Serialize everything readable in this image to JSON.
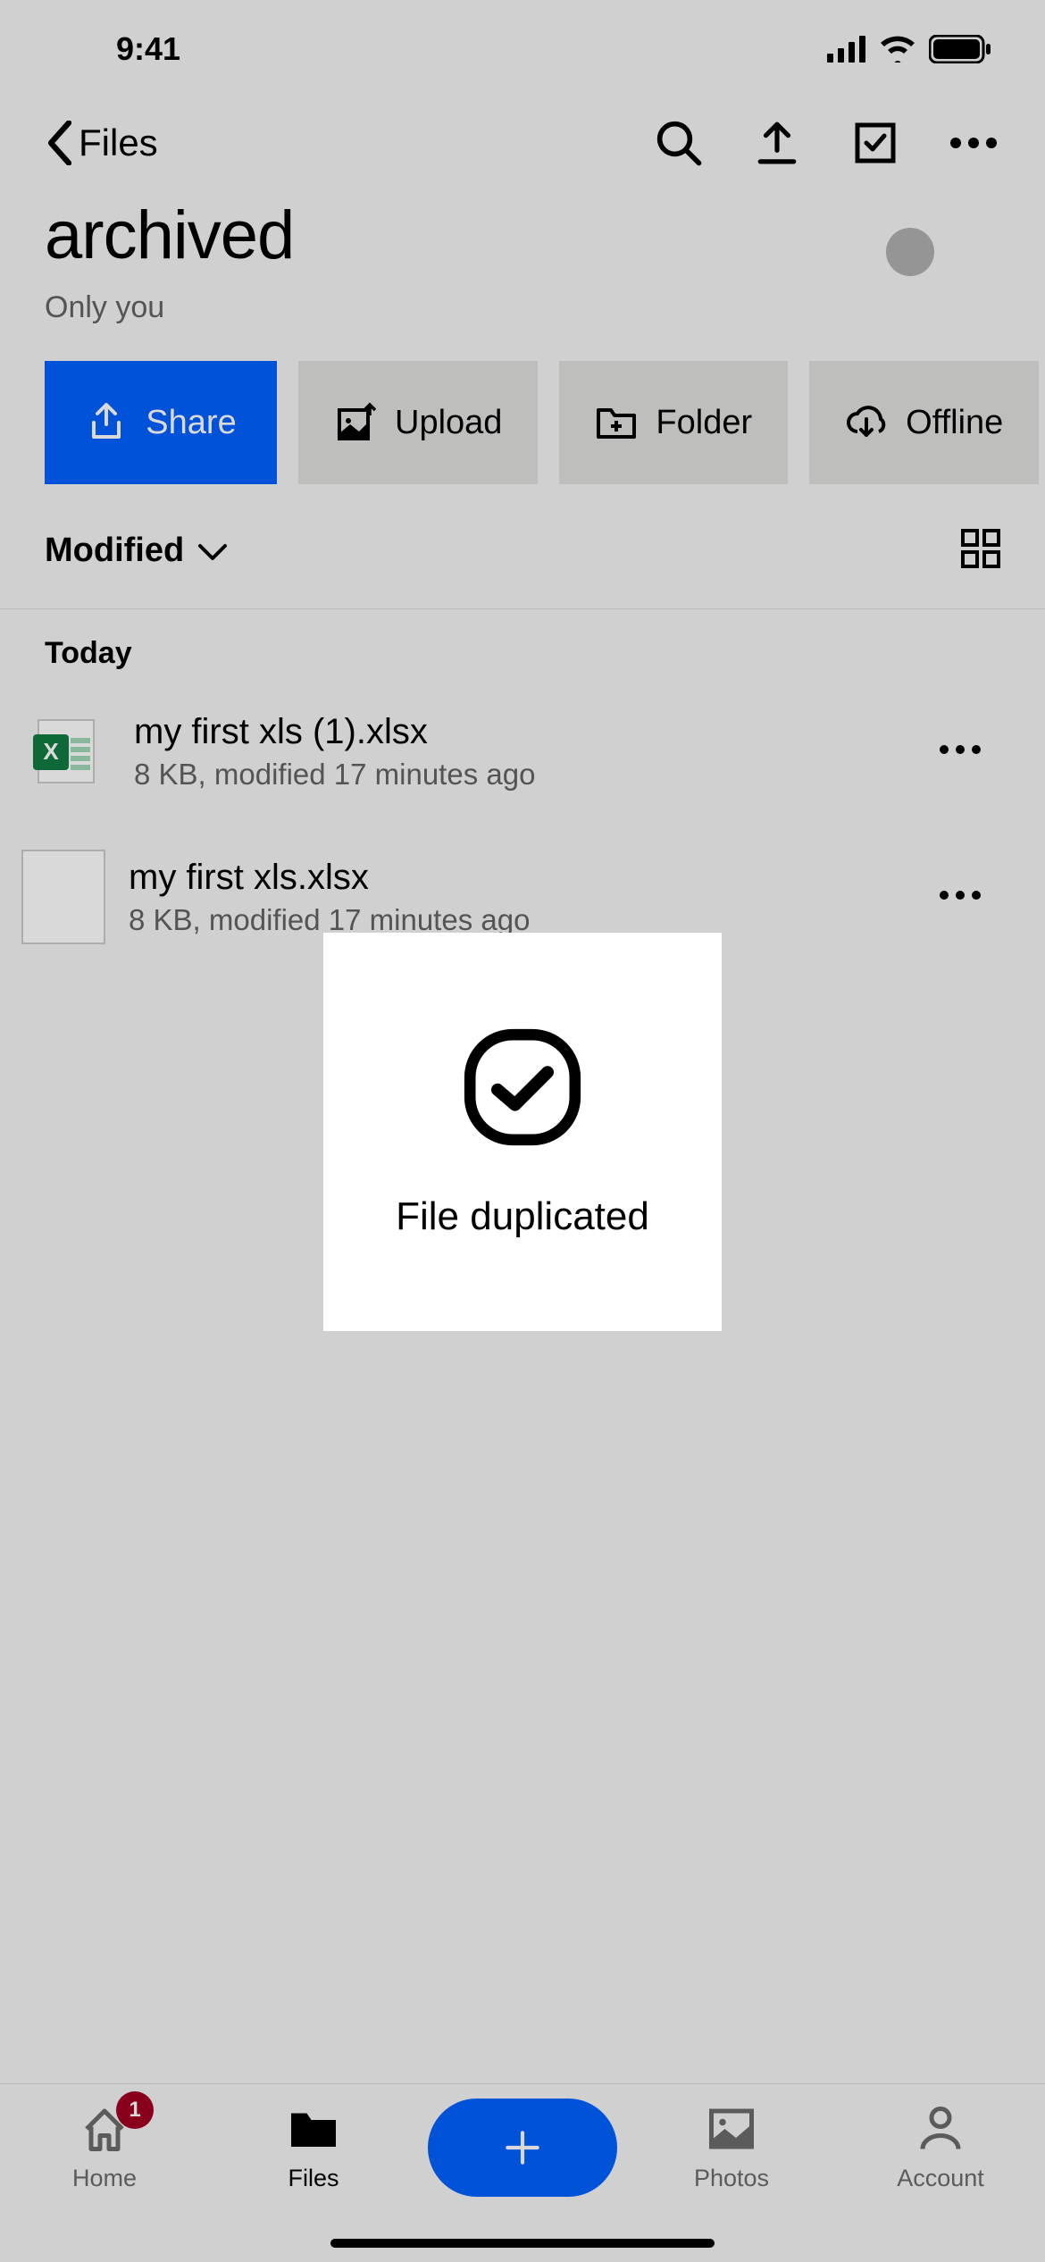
{
  "status": {
    "time": "9:41"
  },
  "nav": {
    "back_label": "Files"
  },
  "folder": {
    "title": "archived",
    "subtitle": "Only you"
  },
  "actions": {
    "share": "Share",
    "upload": "Upload",
    "folder": "Folder",
    "offline": "Offline"
  },
  "sort": {
    "label": "Modified"
  },
  "section": {
    "today": "Today"
  },
  "files": [
    {
      "name": "my first xls (1).xlsx",
      "meta": "8 KB, modified 17 minutes ago"
    },
    {
      "name": "my first xls.xlsx",
      "meta": "8 KB, modified 17 minutes ago"
    }
  ],
  "toast": {
    "message": "File duplicated"
  },
  "tabs": {
    "home": "Home",
    "home_badge": "1",
    "files": "Files",
    "photos": "Photos",
    "account": "Account"
  }
}
